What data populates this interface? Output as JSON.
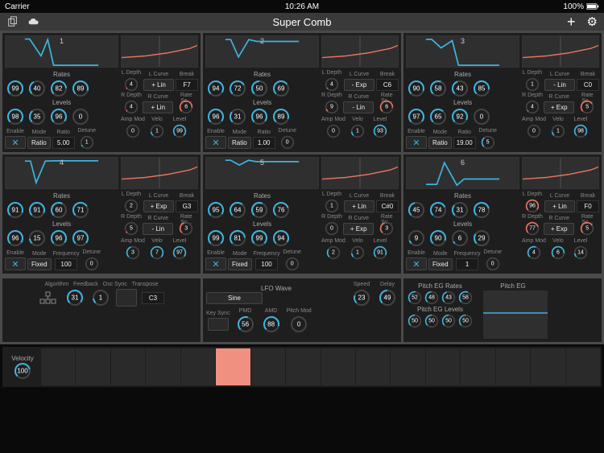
{
  "status": {
    "carrier": "Carrier",
    "time": "10:26 AM",
    "battery": "100%"
  },
  "title": "Super Comb",
  "labels": {
    "rates": "Rates",
    "levels": "Levels",
    "enable": "Enable",
    "mode": "Mode",
    "ratio": "Ratio",
    "frequency": "Frequency",
    "detune": "Detune",
    "ldepth": "L Depth",
    "lcurve": "L Curve",
    "break": "Break",
    "rdepth": "R Depth",
    "rcurve": "R Curve",
    "ratesc": "Rate Sc...",
    "ampmod": "Amp Mod",
    "velo": "Velo",
    "level": "Level",
    "algorithm": "Algorithm",
    "feedback": "Feedback",
    "oscsync": "Osc Sync",
    "transpose": "Transpose",
    "lfowave": "LFO Wave",
    "sine": "Sine",
    "keysync": "Key Sync",
    "pmd": "PMD",
    "amd": "AMD",
    "speed": "Speed",
    "delay": "Delay",
    "pitchmod": "Pitch Mod",
    "pitchegrates": "Pitch EG Rates",
    "pitcheglevels": "Pitch EG Levels",
    "pitcheg": "Pitch EG",
    "velocity": "Velocity",
    "fixed": "Fixed"
  },
  "ops": [
    {
      "n": 1,
      "rates": [
        99,
        40,
        82,
        89
      ],
      "levels": [
        98,
        35,
        96,
        0
      ],
      "mode": "Ratio",
      "ratio": "5.00",
      "detune": 1,
      "ld": 4,
      "lc": "+ Lin",
      "br": "F7",
      "rd": 4,
      "rc": "+ Lin",
      "rs": 6,
      "am": 0,
      "ve": 1,
      "lv": 99,
      "enable": true
    },
    {
      "n": 2,
      "rates": [
        94,
        72,
        50,
        69
      ],
      "levels": [
        96,
        31,
        96,
        89
      ],
      "mode": "Ratio",
      "ratio": "1.00",
      "detune": 0,
      "ld": 4,
      "lc": "- Exp",
      "br": "C6",
      "rd": 9,
      "rc": "- Lin",
      "rs": 6,
      "am": 0,
      "ve": 1,
      "lv": 93,
      "enable": true
    },
    {
      "n": 3,
      "rates": [
        90,
        58,
        43,
        85
      ],
      "levels": [
        97,
        65,
        92,
        0
      ],
      "mode": "Ratio",
      "ratio": "19.00",
      "detune": 5,
      "ld": 1,
      "lc": "- Lin",
      "br": "C0",
      "rd": 4,
      "rc": "+ Exp",
      "rs": 5,
      "am": 0,
      "ve": 1,
      "lv": 98,
      "enable": true
    },
    {
      "n": 4,
      "rates": [
        91,
        91,
        60,
        71
      ],
      "levels": [
        96,
        15,
        96,
        97
      ],
      "mode": "Fixed",
      "ratio": "100",
      "detune": 0,
      "ld": 2,
      "lc": "+ Exp",
      "br": "G3",
      "rd": 5,
      "rc": "- Lin",
      "rs": 3,
      "am": 3,
      "ve": 7,
      "lv": 97,
      "enable": true
    },
    {
      "n": 5,
      "rates": [
        95,
        64,
        59,
        76
      ],
      "levels": [
        99,
        81,
        99,
        94
      ],
      "mode": "Fixed",
      "ratio": "100",
      "detune": 0,
      "ld": 1,
      "lc": "+ Lin",
      "br": "C#0",
      "rd": 0,
      "rc": "+ Exp",
      "rs": 3,
      "am": 2,
      "ve": 1,
      "lv": 91,
      "enable": true
    },
    {
      "n": 6,
      "rates": [
        45,
        74,
        31,
        78
      ],
      "levels": [
        9,
        90,
        6,
        29
      ],
      "mode": "Fixed",
      "ratio": "1",
      "detune": 0,
      "ld": 96,
      "lc": "+ Lin",
      "br": "F0",
      "rd": 77,
      "rc": "+ Exp",
      "rs": 5,
      "am": 4,
      "ve": 6,
      "lv": 14,
      "enable": true
    }
  ],
  "global": {
    "algorithm": 31,
    "feedback": 1,
    "transpose": "C3"
  },
  "lfo": {
    "wave": "Sine",
    "speed": 23,
    "delay": 49,
    "pmd": 56,
    "amd": 88,
    "pitchmod": 0
  },
  "pitcheg": {
    "rates": [
      52,
      48,
      43,
      58
    ],
    "levels": [
      50,
      50,
      50,
      50
    ]
  },
  "velocity": {
    "value": 100,
    "bars": [
      0,
      0,
      0,
      0,
      0,
      100,
      0,
      0,
      0,
      0,
      0,
      0,
      0,
      0,
      0,
      0
    ]
  }
}
